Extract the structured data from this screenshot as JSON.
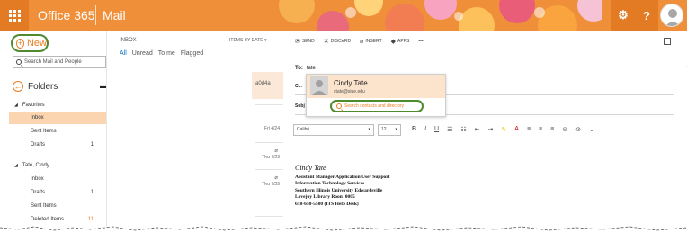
{
  "topbar": {
    "brand": "Office 365",
    "app": "Mail",
    "accent": "#f08f3a",
    "settings_icon": "gear-icon",
    "help_label": "?"
  },
  "left": {
    "new_label": "New",
    "search_placeholder": "Search Mail and People",
    "folders_label": "Folders",
    "favorites_label": "Favorites",
    "favorites": [
      {
        "label": "Inbox",
        "count": ""
      },
      {
        "label": "Sent Items",
        "count": ""
      },
      {
        "label": "Drafts",
        "count": "1"
      }
    ],
    "account_label": "Tate, Cindy",
    "account_folders": [
      {
        "label": "Inbox",
        "count": ""
      },
      {
        "label": "Drafts",
        "count": "1"
      },
      {
        "label": "Sent Items",
        "count": ""
      },
      {
        "label": "Deleted Items",
        "count": "11"
      }
    ]
  },
  "list": {
    "title": "INBOX",
    "sort": "ITEMS BY DATE",
    "filters": [
      "All",
      "Unread",
      "To me",
      "Flagged"
    ],
    "selected_snippet": "a0d4a",
    "dates": [
      "Fri 4/24",
      "Thu 4/23",
      "Thu 4/23"
    ]
  },
  "compose": {
    "toolbar": [
      "SEND",
      "DISCARD",
      "INSERT",
      "APPS"
    ],
    "more": "•••",
    "to_label": "To:",
    "to_value": "tate",
    "cc_label": "Cc:",
    "subject_label": "Subj",
    "font_name": "Calibri",
    "font_size": "12",
    "signature": {
      "name": "Cindy Tate",
      "lines": [
        "Assistant Manager Application User Support",
        "Information Technology Services",
        "Southern Illinois University Edwardsville",
        "Lovejoy Library Room 0005",
        "618-650-5500 (ITS Help Desk)"
      ]
    }
  },
  "popup": {
    "name": "Cindy Tate",
    "email": "ctate@siue.edu",
    "search_label": "Search contacts and directory"
  }
}
